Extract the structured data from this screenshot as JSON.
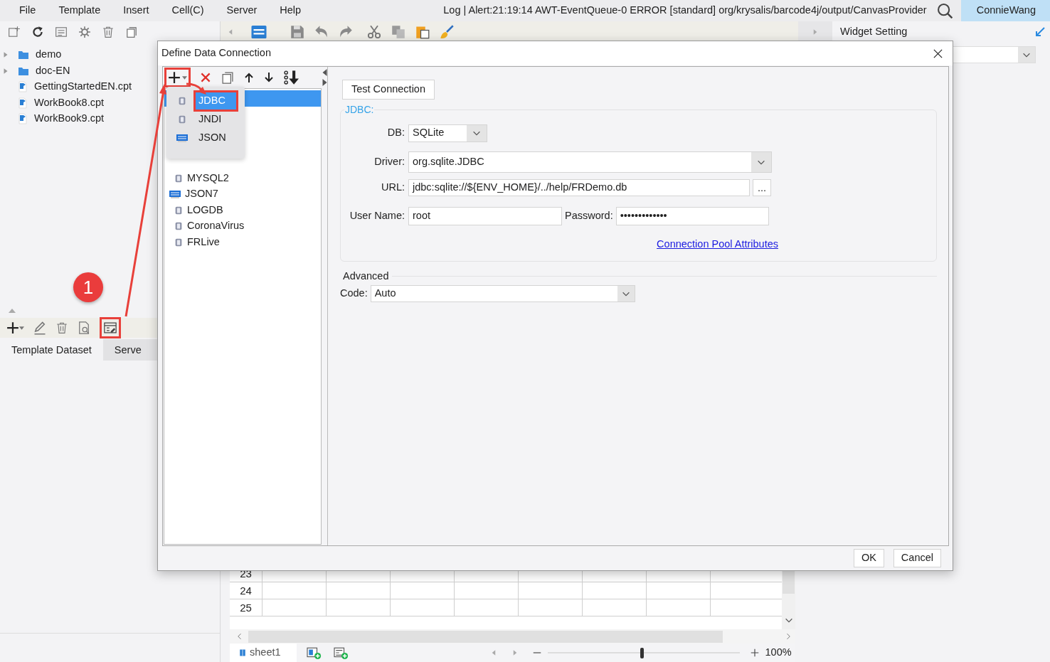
{
  "menu_bar": {
    "items": [
      "File",
      "Template",
      "Insert",
      "Cell(C)",
      "Server",
      "Help"
    ],
    "log": "Log | Alert:21:19:14 AWT-EventQueue-0 ERROR [standard] org/krysalis/barcode4j/output/CanvasProvider",
    "user": "ConnieWang"
  },
  "file_tree": [
    {
      "name": "demo",
      "kind": "folder",
      "expanded": false
    },
    {
      "name": "doc-EN",
      "kind": "folder",
      "expanded": false
    },
    {
      "name": "GettingStartedEN.cpt",
      "kind": "file"
    },
    {
      "name": "WorkBook8.cpt",
      "kind": "file"
    },
    {
      "name": "WorkBook9.cpt",
      "kind": "file"
    }
  ],
  "dataset_panel": {
    "connection_button_highlighted": true,
    "tabs": [
      {
        "label": "Template Dataset",
        "selected": true
      },
      {
        "label": "Serve",
        "selected": false
      }
    ]
  },
  "right_panel": {
    "title": "Widget Setting"
  },
  "sheet": {
    "rows": [
      "23",
      "24",
      "25"
    ],
    "tab": "sheet1",
    "zoom": {
      "level": 0.49,
      "reading": "100%"
    }
  },
  "dialog": {
    "title": "Define Data Connection",
    "add_button_highlighted": true,
    "connections": [
      {
        "selected": true
      },
      {
        "name": "MYSQL2",
        "kind": "db",
        "selected": false
      },
      {
        "name": "JSON7",
        "kind": "json",
        "selected": false
      },
      {
        "name": "LOGDB",
        "kind": "db",
        "selected": false
      },
      {
        "name": "CoronaVirus",
        "kind": "db",
        "selected": false
      },
      {
        "name": "FRLive",
        "kind": "db",
        "selected": false
      }
    ],
    "test_button": "Test Connection",
    "jdbc": {
      "legend": "JDBC:",
      "db_label": "DB:",
      "db": "SQLite",
      "driver_label": "Driver:",
      "driver": "org.sqlite.JDBC",
      "url_label": "URL:",
      "url": "jdbc:sqlite://${ENV_HOME}/../help/FRDemo.db",
      "browse": "...",
      "user_label": "User Name:",
      "user": "root",
      "password_label": "Password:",
      "password": "•••••••••••••",
      "pool_link": "Connection Pool Attributes"
    },
    "advanced": {
      "legend": "Advanced",
      "code_label": "Code:",
      "code": "Auto"
    },
    "buttons": [
      "OK",
      "Cancel"
    ]
  },
  "popup_menu": [
    {
      "label": "JDBC",
      "kind": "db",
      "selected": true,
      "highlighted": true
    },
    {
      "label": "JNDI",
      "kind": "db",
      "selected": false,
      "highlighted": false
    },
    {
      "label": "JSON",
      "kind": "json",
      "selected": false,
      "highlighted": false
    }
  ],
  "annotation": {
    "badge": "1"
  }
}
